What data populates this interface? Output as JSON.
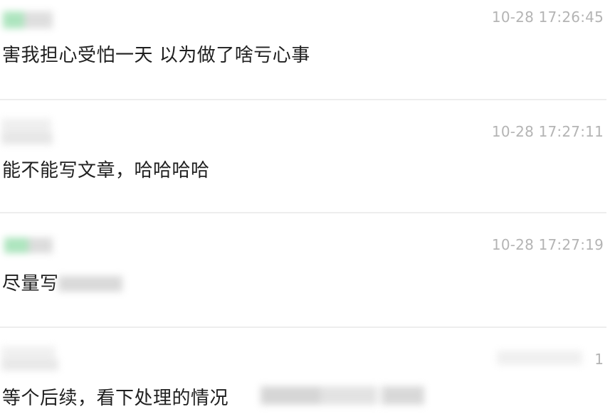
{
  "comments": [
    {
      "timestamp": "10-28 17:26:45",
      "text": "害我担心受怕一天 以为做了啥亏心事"
    },
    {
      "timestamp": "10-28 17:27:11",
      "text": "能不能写文章，哈哈哈哈"
    },
    {
      "timestamp": "10-28 17:27:19",
      "text": "尽量写"
    },
    {
      "timestamp": "",
      "text": "等个后续，看下处理的情况",
      "like_count": "1"
    }
  ],
  "colors": {
    "timestamp": "#b4b4b4",
    "text": "#1f1f1f",
    "divider": "#ededed",
    "avatar_green": "#8fdca8"
  }
}
